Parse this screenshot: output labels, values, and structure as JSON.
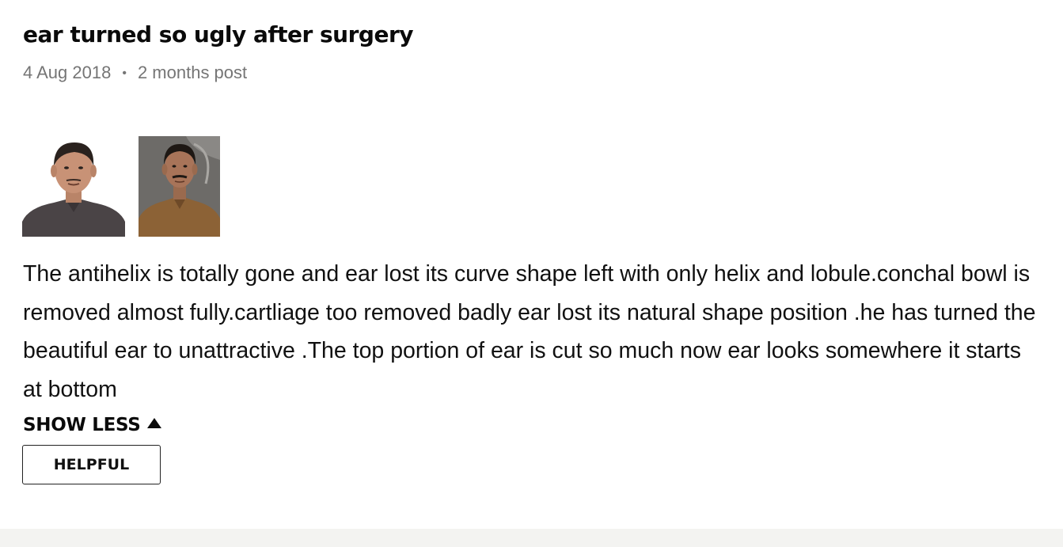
{
  "post": {
    "title": "ear turned so ugly after surgery",
    "date": "4 Aug 2018",
    "separator": "•",
    "relative_time": "2 months post",
    "photos": [
      {
        "name": "photo-before",
        "icon": "person-photo-icon",
        "background": "#ffffff",
        "shirt_color": "#4a4446"
      },
      {
        "name": "photo-after",
        "icon": "person-photo-icon",
        "background": "#6d6b68",
        "shirt_color": "#8c6236"
      }
    ],
    "body": "The antihelix is totally gone and ear lost its curve shape left with only helix and lobule.conchal bowl is removed almost fully.cartliage too removed badly ear lost its natural shape position .he has turned the beautiful ear to unattractive .The top portion of ear is cut so much now ear looks somewhere it starts at bottom",
    "show_less_label": "SHOW LESS",
    "show_less_icon": "caret-up-icon",
    "helpful_label": "HELPFUL"
  },
  "colors": {
    "text": "#111111",
    "meta": "#757575",
    "footer_band": "#f3f3f1"
  }
}
